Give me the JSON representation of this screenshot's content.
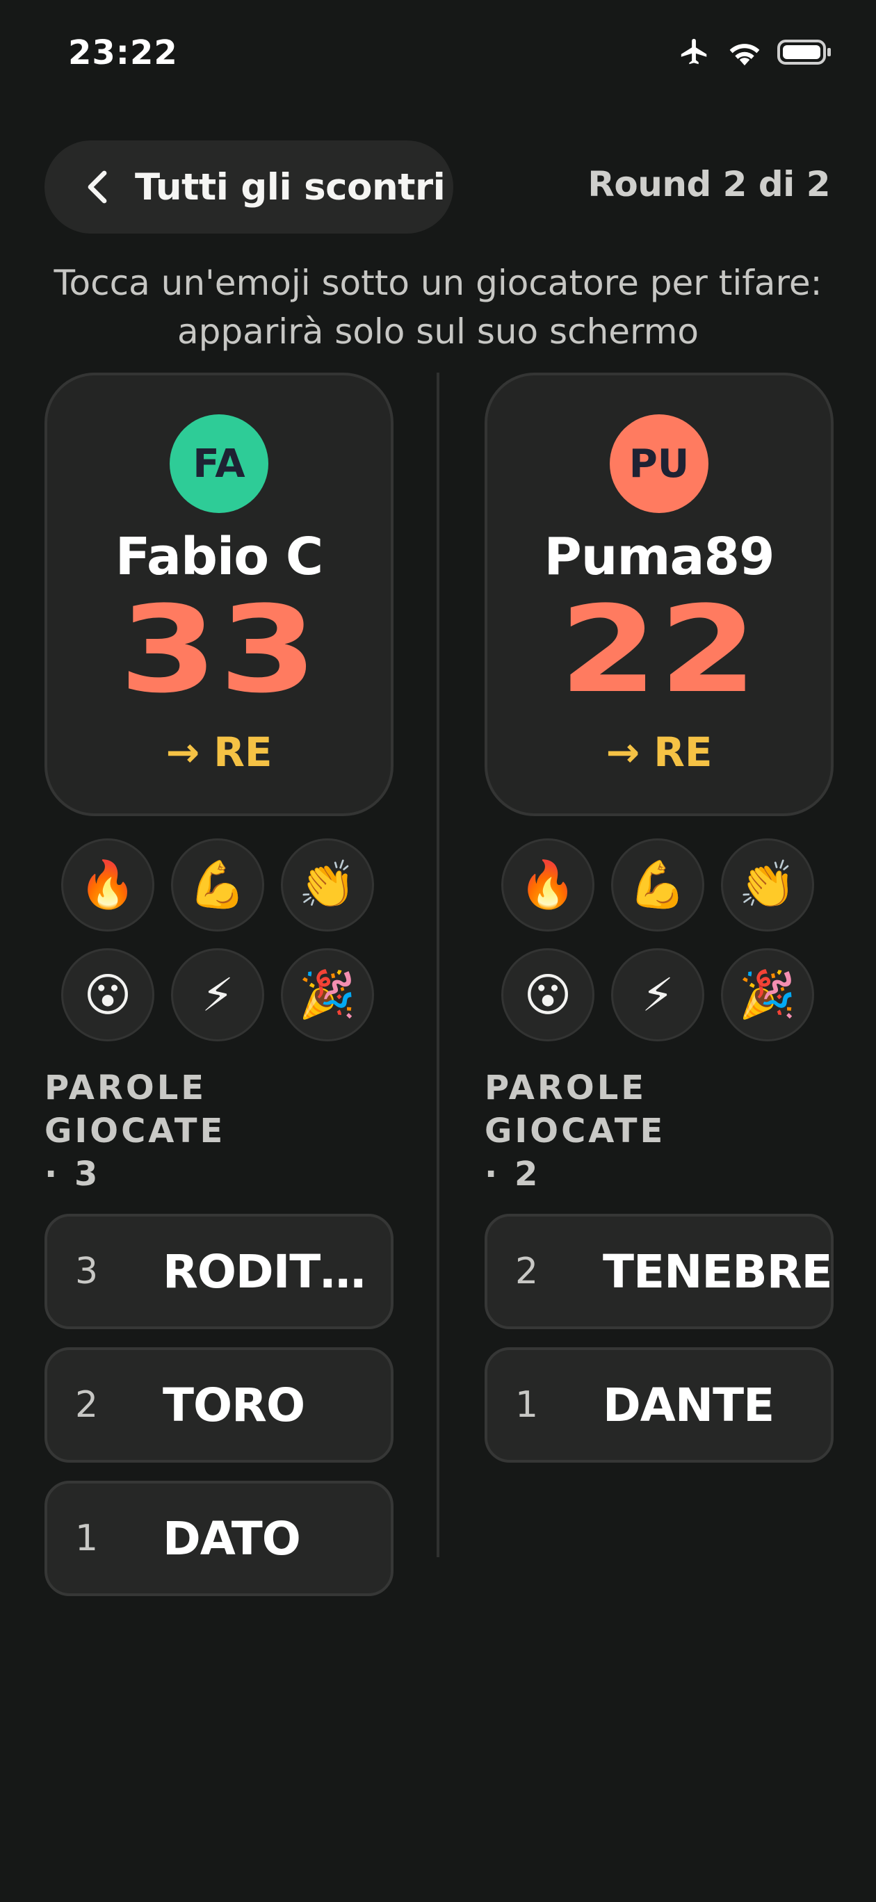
{
  "status_bar": {
    "time": "23:22",
    "icons": [
      "airplane-icon",
      "wifi-icon",
      "battery-icon"
    ]
  },
  "header": {
    "back_label": "Tutti gli scontri",
    "round_label": "Round 2 di 2"
  },
  "instructions": {
    "line1": "Tocca un'emoji sotto un giocatore per tifare:",
    "line2": "apparirà solo sul suo schermo"
  },
  "emoji_reactions": [
    "🔥",
    "💪",
    "👏",
    "😮",
    "⚡",
    "🎉"
  ],
  "players": [
    {
      "initials": "FA",
      "name": "Fabio C",
      "score": "33",
      "next": "→ RE",
      "avatar_color": "#2ecc97",
      "words_title": "PAROLE GIOCATE",
      "words_count": "· 3",
      "words": [
        {
          "rank": "3",
          "word": "RODIT…"
        },
        {
          "rank": "2",
          "word": "TORO"
        },
        {
          "rank": "1",
          "word": "DATO"
        }
      ]
    },
    {
      "initials": "PU",
      "name": "Puma89",
      "score": "22",
      "next": "→ RE",
      "avatar_color": "#ff7b60",
      "words_title": "PAROLE GIOCATE",
      "words_count": "· 2",
      "words": [
        {
          "rank": "2",
          "word": "TENEBRE"
        },
        {
          "rank": "1",
          "word": "DANTE"
        }
      ]
    }
  ],
  "colors": {
    "background": "#161817",
    "card": "#242524",
    "score": "#ff7b60",
    "accent_yellow": "#f5c245"
  }
}
